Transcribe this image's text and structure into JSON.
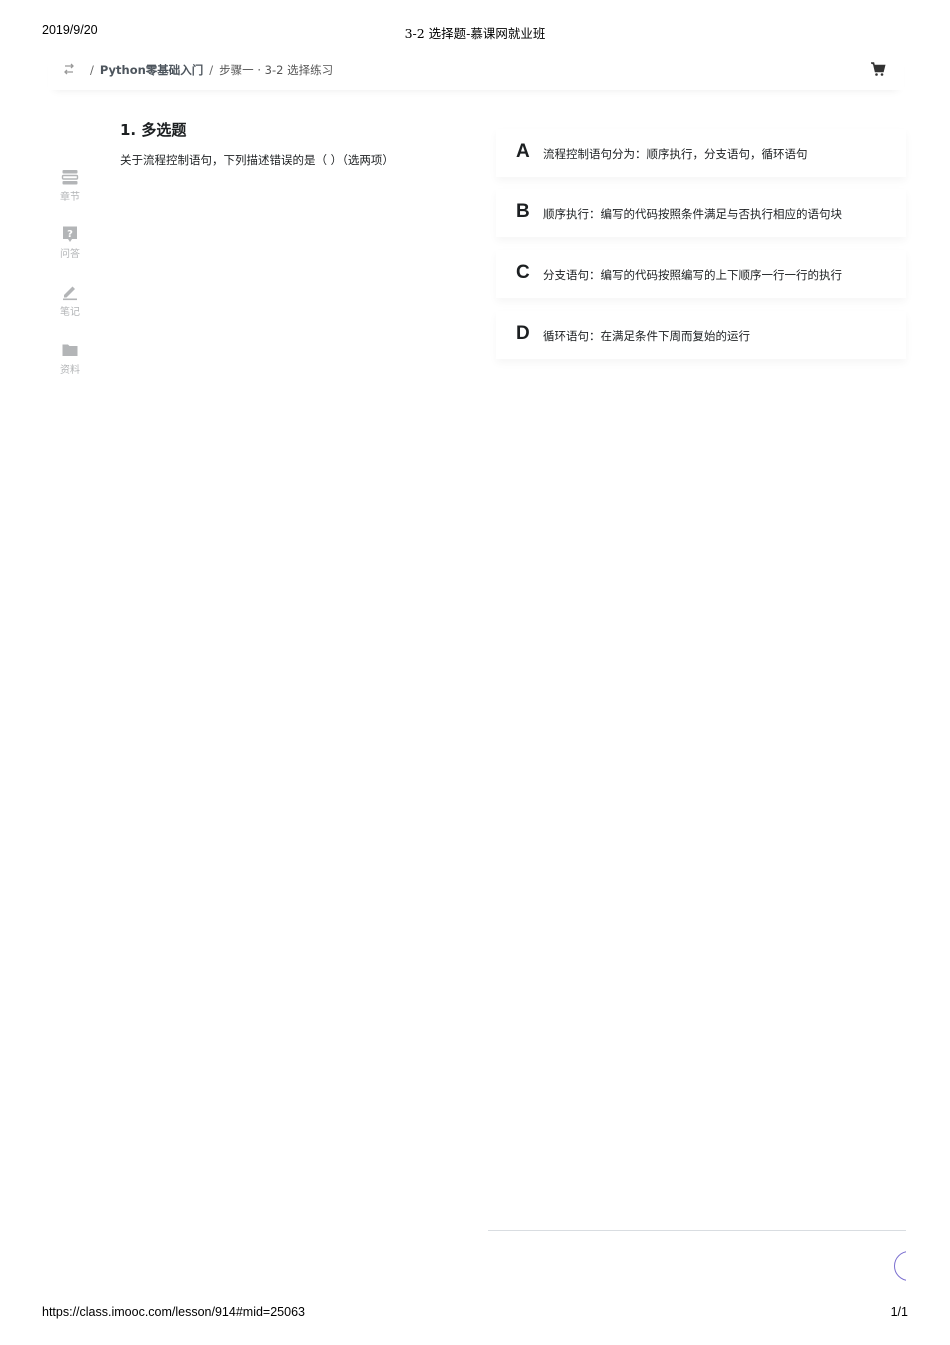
{
  "print_header": {
    "date": "2019/9/20",
    "title": "3-2 选择题-慕课网就业班"
  },
  "print_footer": {
    "url": "https://class.imooc.com/lesson/914#mid=25063",
    "page": "1/1"
  },
  "breadcrumb": {
    "separator": "/",
    "course": "Python零基础入门",
    "lesson": "步骤一 · 3-2 选择练习"
  },
  "sidebar": {
    "items": [
      {
        "label": "章节",
        "icon": "chapter-icon"
      },
      {
        "label": "问答",
        "icon": "question-icon"
      },
      {
        "label": "笔记",
        "icon": "note-pen-icon"
      },
      {
        "label": "资料",
        "icon": "folder-icon"
      }
    ]
  },
  "question": {
    "title": "1. 多选题",
    "text": "关于流程控制语句，下列描述错误的是（ ）（选两项）"
  },
  "options": [
    {
      "letter": "A",
      "text": "流程控制语句分为：顺序执行，分支语句，循环语句"
    },
    {
      "letter": "B",
      "text": "顺序执行：编写的代码按照条件满足与否执行相应的语句块"
    },
    {
      "letter": "C",
      "text": "分支语句：编写的代码按照编写的上下顺序一行一行的执行"
    },
    {
      "letter": "D",
      "text": "循环语句：在满足条件下周而复始的运行"
    }
  ],
  "colors": {
    "text": "#1c1f21",
    "muted": "#b3b5b7",
    "accent": "#7b6fd0"
  }
}
